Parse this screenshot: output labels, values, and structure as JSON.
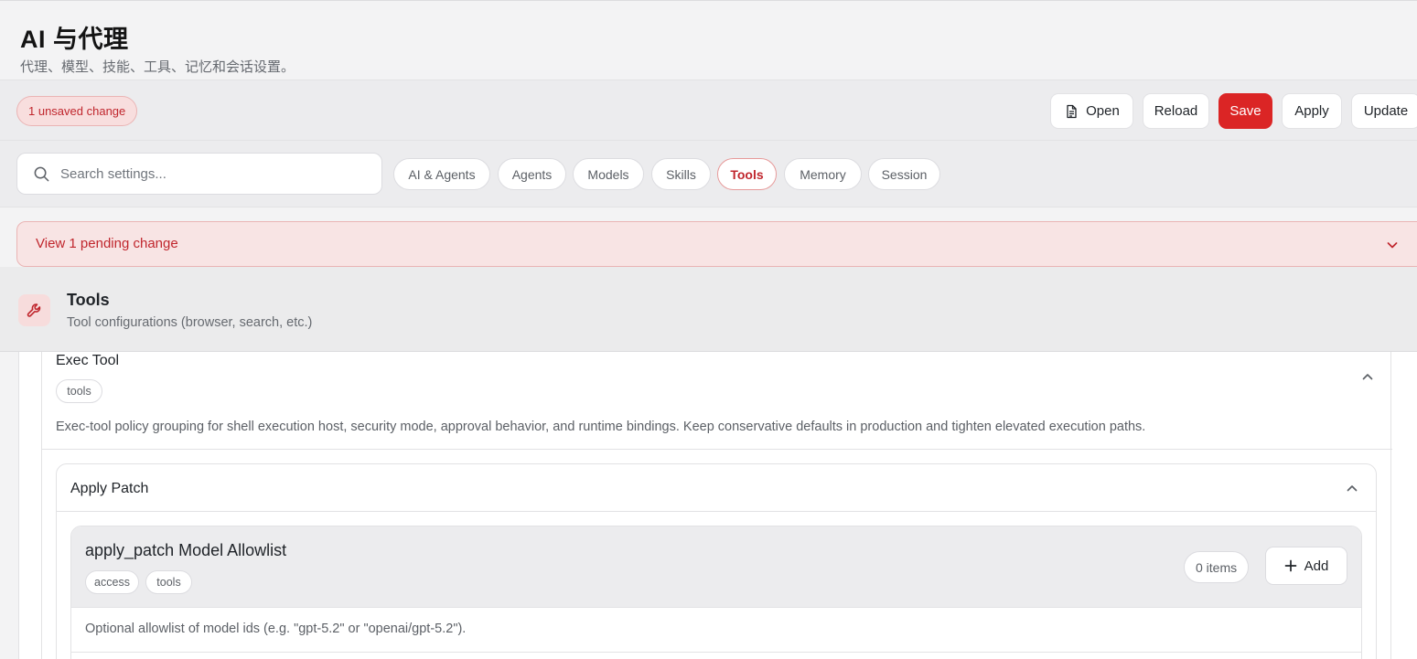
{
  "header": {
    "title": "AI 与代理",
    "subtitle": "代理、模型、技能、工具、记忆和会话设置。"
  },
  "actionbar": {
    "unsaved_badge": "1 unsaved change",
    "buttons": {
      "open": "Open",
      "reload": "Reload",
      "save": "Save",
      "apply": "Apply",
      "update": "Update"
    }
  },
  "search": {
    "placeholder": "Search settings...",
    "value": ""
  },
  "filters": [
    {
      "label": "AI & Agents",
      "active": false
    },
    {
      "label": "Agents",
      "active": false
    },
    {
      "label": "Models",
      "active": false
    },
    {
      "label": "Skills",
      "active": false
    },
    {
      "label": "Tools",
      "active": true
    },
    {
      "label": "Memory",
      "active": false
    },
    {
      "label": "Session",
      "active": false
    }
  ],
  "pending": {
    "label": "View 1 pending change"
  },
  "section": {
    "title": "Tools",
    "description": "Tool configurations (browser, search, etc.)",
    "icon": "wrench-icon"
  },
  "exec_tool": {
    "title": "Exec Tool",
    "tag": "tools",
    "description": "Exec-tool policy grouping for shell execution host, security mode, approval behavior, and runtime bindings. Keep conservative defaults in production and tighten elevated execution paths."
  },
  "apply_patch": {
    "title": "Apply Patch",
    "allowlist": {
      "title": "apply_patch Model Allowlist",
      "tags": [
        "access",
        "tools"
      ],
      "count": "0 items",
      "add_label": "Add",
      "description": "Optional allowlist of model ids (e.g. \"gpt-5.2\" or \"openai/gpt-5.2\")."
    }
  },
  "colors": {
    "accent": "#db2525",
    "accent_text": "#c0262d",
    "accent_bg": "#f8e4e4"
  }
}
